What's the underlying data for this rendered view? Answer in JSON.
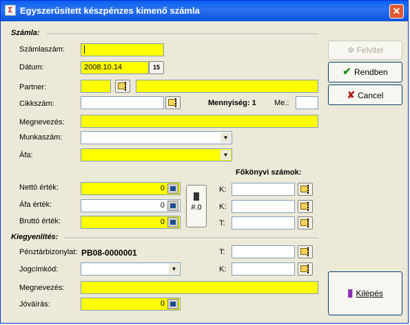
{
  "window": {
    "title": "Egyszerűsített készpénzes kimenő számla"
  },
  "szamla": {
    "section_label": "Számla:",
    "szamlaszam_label": "Számlaszám:",
    "szamlaszam_value": "",
    "datum_label": "Dátum:",
    "datum_value": "2008.10.14",
    "datum_btn": "15",
    "partner_label": "Partner:",
    "partner_code": "",
    "partner_name": "",
    "cikkszam_label": "Cikkszám:",
    "cikkszam_value": "",
    "mennyiseg_label": "Mennyiség: 1",
    "me_label": "Me.:",
    "me_value": "",
    "megnevezes_label": "Megnevezés:",
    "megnevezes_value": "",
    "munkaszam_label": "Munkaszám:",
    "munkaszam_value": "",
    "afa_label": "Áfa:",
    "afa_value": ""
  },
  "ertekek": {
    "netto_label": "Nettó érték:",
    "netto_value": "0",
    "afa_ertek_label": "Áfa érték:",
    "afa_ertek_value": "0",
    "brutto_label": "Bruttó érték:",
    "brutto_value": "0",
    "round_btn": "#.0"
  },
  "fokonyv": {
    "title": "Főkönyvi számok:",
    "rows": [
      {
        "label": "K:",
        "value": ""
      },
      {
        "label": "K:",
        "value": ""
      },
      {
        "label": "T:",
        "value": ""
      }
    ]
  },
  "kiegyenlites": {
    "section_label": "Kiegyenlítés:",
    "penztar_label": "Pénztárbizonylat:",
    "penztar_value": "PB08-0000001",
    "t_label": "T:",
    "t_value": "",
    "jogcim_label": "Jogcímkód:",
    "jogcim_value": "",
    "k_label": "K:",
    "k_value": "",
    "megnevezes_label": "Megnevezés:",
    "megnevezes_value": "",
    "jovairas_label": "Jóváírás:",
    "jovairas_value": "0"
  },
  "buttons": {
    "felvitel": "Felvitel",
    "rendben": "Rendben",
    "cancel": "Cancel",
    "kilepes": "Kilépés"
  },
  "colors": {
    "required_field": "#ffff00",
    "title_bar": "#0a5ef0",
    "window_bg": "#ece9d8"
  }
}
